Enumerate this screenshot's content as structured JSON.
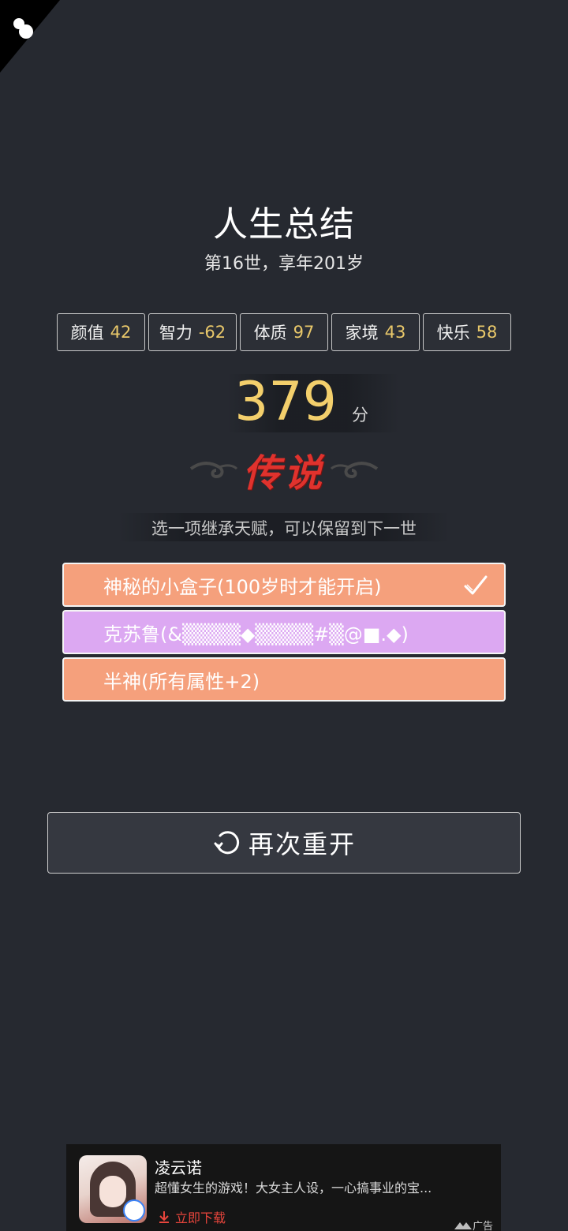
{
  "summary": {
    "title": "人生总结",
    "subtitle": "第16世，享年201岁"
  },
  "stats": [
    {
      "label": "颜值",
      "value": "42"
    },
    {
      "label": "智力",
      "value": "-62"
    },
    {
      "label": "体质",
      "value": "97"
    },
    {
      "label": "家境",
      "value": "43"
    },
    {
      "label": "快乐",
      "value": "58"
    }
  ],
  "score": {
    "value": "379",
    "unit": "分"
  },
  "rank": {
    "label": "传说",
    "color": "#e0322d"
  },
  "inherit": {
    "hint": "选一项继承天赋，可以保留到下一世",
    "talents": [
      {
        "label": "神秘的小盒子(100岁时才能开启)",
        "color": "#f5a07c",
        "selected": true
      },
      {
        "label": "克苏鲁(&▒▒▒▒◆▒▒▒▒#▒@■.◆)",
        "color": "#dca8f2",
        "selected": false
      },
      {
        "label": "半神(所有属性+2)",
        "color": "#f5a07c",
        "selected": false
      }
    ]
  },
  "restart": {
    "label": "再次重开",
    "icon": "refresh-icon"
  },
  "ad": {
    "title": "凌云诺",
    "description": "超懂女生的游戏！大女主人设，一心搞事业的宝...",
    "cta": "立即下载",
    "tag": "广告"
  },
  "colors": {
    "background": "#262930",
    "accent_gold": "#e9c86a",
    "orange": "#f5a07c",
    "purple": "#dca8f2"
  }
}
